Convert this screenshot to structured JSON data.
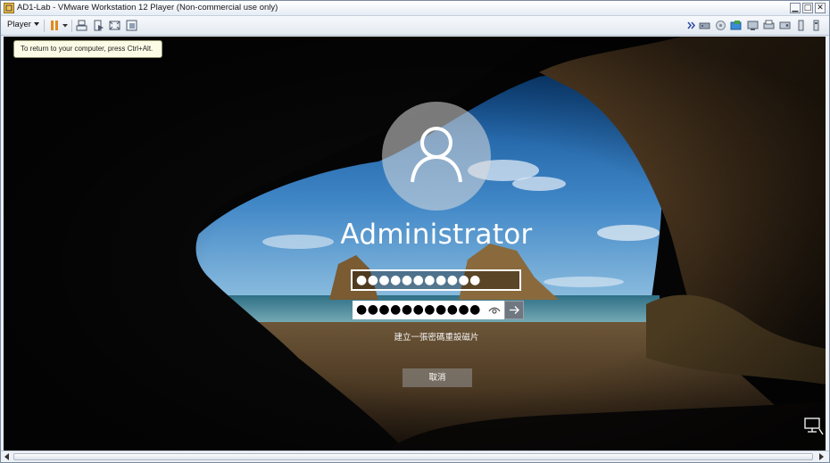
{
  "window": {
    "title": "AD1-Lab - VMware Workstation 12 Player (Non-commercial use only)",
    "minimize_glyph": "▁",
    "maximize_glyph": "□",
    "close_glyph": "✕"
  },
  "toolbar": {
    "player_menu_label": "Player",
    "icons": [
      "pause-icon",
      "send-ctrl-alt-del-icon",
      "removable-devices-icon",
      "fullscreen-icon",
      "unity-icon",
      "more-chevron-icon",
      "network-adapter-icon",
      "cd-dvd-icon",
      "shared-folders-icon",
      "display-icon",
      "printer-icon",
      "sound-icon",
      "usb-icon",
      "usb-device-icon"
    ]
  },
  "tooltip": {
    "text": "To return to your computer, press Ctrl+Alt."
  },
  "login": {
    "username": "Administrator",
    "old_password_mask": "●●●●●●●●●●●",
    "new_password_mask": "●●●●●●●●●●●",
    "reset_link": "建立一張密碼重設磁片",
    "cancel_label": "取消"
  },
  "colors": {
    "title_text": "#1a1a1a",
    "tooltip_bg": "#fbfbe6",
    "login_text": "#ffffff",
    "accent_pause": "#e08a1e"
  }
}
